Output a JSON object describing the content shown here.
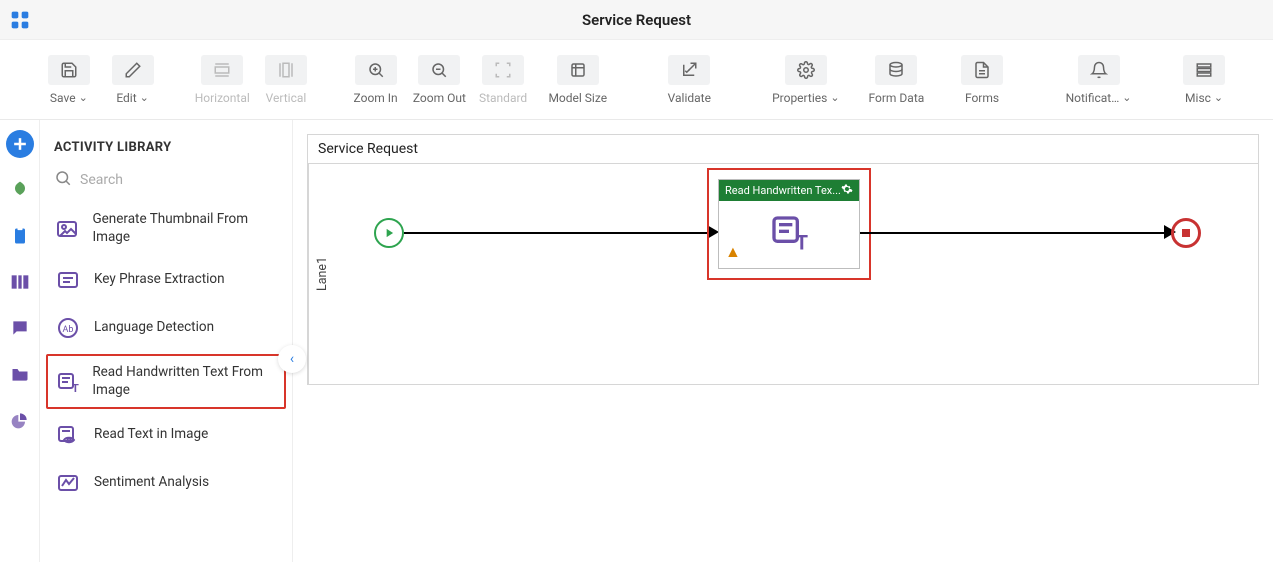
{
  "header": {
    "title": "Service Request"
  },
  "toolbar": {
    "save": "Save",
    "edit": "Edit",
    "horizontal": "Horizontal",
    "vertical": "Vertical",
    "zoom_in": "Zoom In",
    "zoom_out": "Zoom Out",
    "standard": "Standard",
    "model_size": "Model Size",
    "validate": "Validate",
    "properties": "Properties",
    "form_data": "Form Data",
    "forms": "Forms",
    "notifications": "Notificat…",
    "misc": "Misc"
  },
  "sidebar": {
    "title": "ACTIVITY LIBRARY",
    "search_placeholder": "Search",
    "items": [
      {
        "label": "Generate Thumbnail From Image"
      },
      {
        "label": "Key Phrase Extraction"
      },
      {
        "label": "Language Detection"
      },
      {
        "label": "Read Handwritten Text From Image"
      },
      {
        "label": "Read Text in Image"
      },
      {
        "label": "Sentiment Analysis"
      }
    ]
  },
  "process": {
    "title": "Service Request",
    "lane_label": "Lane1",
    "activity_label": "Read Handwritten Tex..."
  }
}
